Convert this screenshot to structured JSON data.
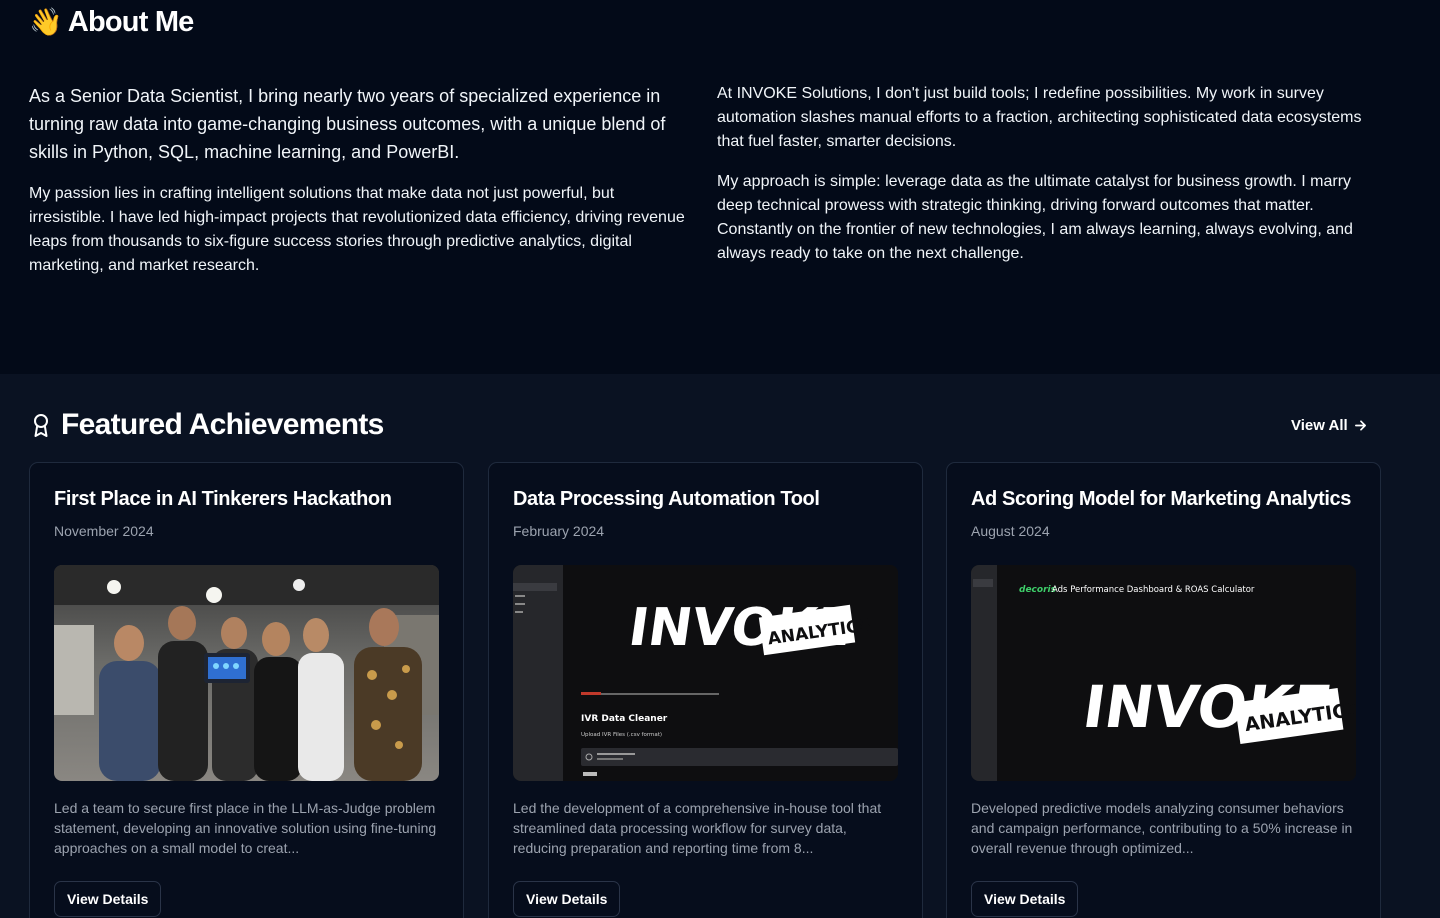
{
  "about": {
    "emoji": "👋",
    "title": "About Me",
    "left": {
      "lead": "As a Senior Data Scientist, I bring nearly two years of specialized experience in turning raw data into game-changing business outcomes, with a unique blend of skills in Python, SQL, machine learning, and PowerBI.",
      "paragraph": "My passion lies in crafting intelligent solutions that make data not just powerful, but irresistible. I have led high-impact projects that revolutionized data efficiency, driving revenue leaps from thousands to six-figure success stories through predictive analytics, digital marketing, and market research."
    },
    "right": {
      "paragraph1": "At INVOKE Solutions, I don't just build tools; I redefine possibilities. My work in survey automation slashes manual efforts to a fraction, architecting sophisticated data ecosystems that fuel faster, smarter decisions.",
      "paragraph2": "My approach is simple: leverage data as the ultimate catalyst for business growth. I marry deep technical prowess with strategic thinking, driving forward outcomes that matter. Constantly on the frontier of new technologies, I am always learning, always evolving, and always ready to take on the next challenge."
    }
  },
  "achievements": {
    "title": "Featured Achievements",
    "view_all": "View All",
    "cards": [
      {
        "title": "First Place in AI Tinkerers Hackathon",
        "date": "November 2024",
        "description": "Led a team to secure first place in the LLM-as-Judge problem statement, developing an innovative solution using fine-tuning approaches on a small model to creat...",
        "button": "View Details"
      },
      {
        "title": "Data Processing Automation Tool",
        "date": "February 2024",
        "description": "Led the development of a comprehensive in-house tool that streamlined data processing workflow for survey data, reducing preparation and reporting time from 8...",
        "button": "View Details",
        "image": {
          "logo_main": "INVOKE",
          "logo_sub": "ANALYTICS",
          "app_title": "IVR Data Cleaner",
          "upload_label": "Upload IVR Files (.csv format)"
        }
      },
      {
        "title": "Ad Scoring Model for Marketing Analytics",
        "date": "August 2024",
        "description": "Developed predictive models analyzing consumer behaviors and campaign performance, contributing to a 50% increase in overall revenue through optimized...",
        "button": "View Details",
        "image": {
          "brand": "decoris",
          "dashboard_title": "Ads Performance Dashboard & ROAS Calculator",
          "logo_main": "INVOKE",
          "logo_sub": "ANALYTICS"
        }
      }
    ]
  }
}
